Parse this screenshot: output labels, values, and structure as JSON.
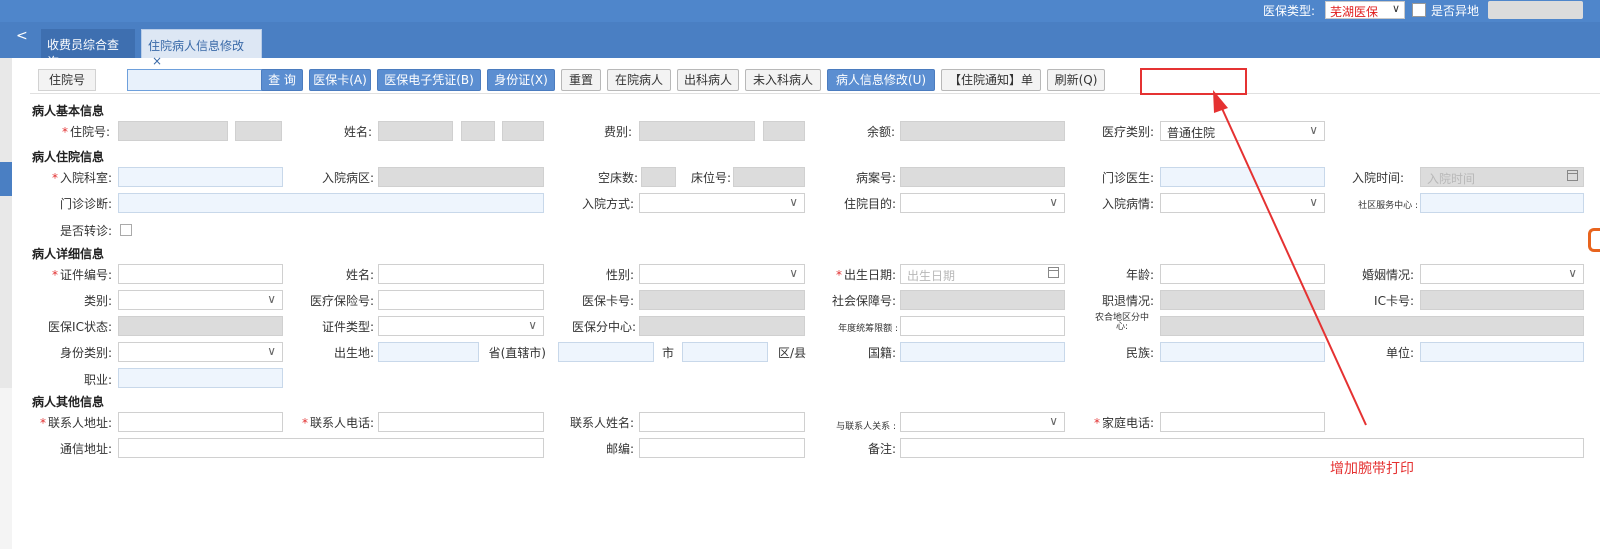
{
  "topbar": {
    "insurance_type_label": "医保类型:",
    "insurance_type_value": "芜湖医保",
    "remote_label": "是否异地"
  },
  "tabs": [
    {
      "label": "收费员综合查询"
    },
    {
      "label": "住院病人信息修改",
      "close": "×"
    }
  ],
  "toolbar": {
    "input_label": "住院号",
    "buttons": [
      "查 询",
      "医保卡(A)",
      "医保电子凭证(B)",
      "身份证(X)",
      "重置",
      "在院病人",
      "出科病人",
      "未入科病人",
      "病人信息修改(U)",
      "【住院通知】单",
      "刷新(Q)"
    ]
  },
  "sections": {
    "basic": "病人基本信息",
    "inpatient": "病人住院信息",
    "detail": "病人详细信息",
    "other": "病人其他信息"
  },
  "required_mark": "*",
  "labels": {
    "admission_no": "住院号:",
    "name": "姓名:",
    "fee_type": "费别:",
    "balance": "余额:",
    "medical_type": "医疗类别:",
    "admit_dept": "入院科室:",
    "admit_ward": "入院病区:",
    "empty_beds": "空床数:",
    "bed_no": "床位号:",
    "room_no": "病案号:",
    "outpatient_doctor": "门诊医生:",
    "admit_time": "入院时间:",
    "outpatient_diag": "门诊诊断:",
    "admit_method": "入院方式:",
    "purpose": "住院目的:",
    "admit_condition": "入院病情:",
    "community_center": "社区服务中心 :",
    "transfer": "是否转诊:",
    "id_no": "证件编号:",
    "name2": "姓名:",
    "gender": "性别:",
    "birth_date": "出生日期:",
    "age": "年龄:",
    "marital": "婚姻情况:",
    "category": "类别:",
    "insurance_no": "医疗保险号:",
    "ins_card_no": "医保卡号:",
    "social_sec_no": "社会保障号:",
    "retire": "职退情况:",
    "ic_card_no": "IC卡号:",
    "ins_ic_status": "医保IC状态:",
    "id_type": "证件类型:",
    "ins_center": "医保分中心:",
    "annual_limit": "年度统筹限额 :",
    "coop_area": "农合地区分中心:",
    "identity_type": "身份类别:",
    "birthplace": "出生地:",
    "province": "省(直辖市)",
    "city": "市",
    "district": "区/县",
    "nationality": "国籍:",
    "ethnicity": "民族:",
    "work_unit": "单位:",
    "occupation": "职业:",
    "contact_addr": "联系人地址:",
    "contact_phone": "联系人电话:",
    "contact_name": "联系人姓名:",
    "contact_relation": "与联系人关系 :",
    "home_phone": "家庭电话:",
    "mail_addr": "通信地址:",
    "postcode": "邮编:",
    "remark": "备注:"
  },
  "values": {
    "medical_type": "普通住院",
    "admit_time_ph": "入院时间",
    "birth_date_ph": "出生日期"
  },
  "annotation": "增加腕带打印",
  "colors": {
    "accent": "#4f86cb",
    "annotation": "#e53232"
  }
}
